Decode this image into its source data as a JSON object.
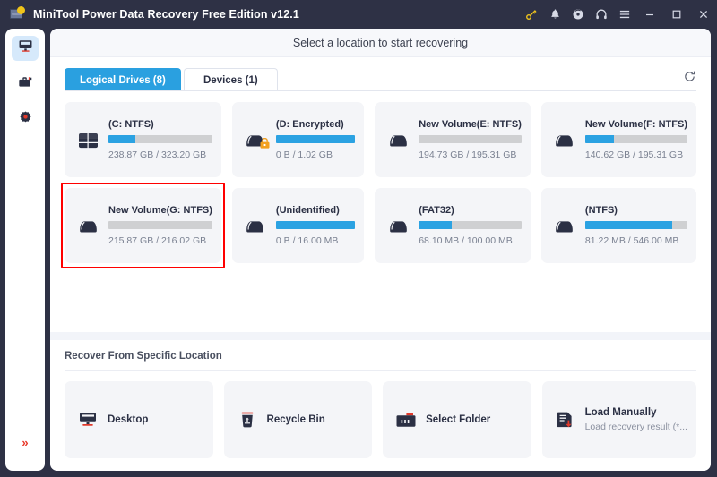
{
  "window": {
    "title": "MiniTool Power Data Recovery Free Edition v12.1",
    "logo_icon": "minitool-logo-icon",
    "controls": [
      {
        "name": "key-icon",
        "glyph": "key"
      },
      {
        "name": "bell-icon",
        "glyph": "bell"
      },
      {
        "name": "disc-icon",
        "glyph": "disc"
      },
      {
        "name": "headphones-icon",
        "glyph": "headphones"
      },
      {
        "name": "menu-icon",
        "glyph": "hamburger"
      },
      {
        "name": "minimize-button",
        "glyph": "minimize"
      },
      {
        "name": "maximize-button",
        "glyph": "maximize"
      },
      {
        "name": "close-button",
        "glyph": "close"
      }
    ],
    "accent_color": "#2aa0e0",
    "titlebar_color": "#2e3145",
    "key_icon_color": "#f2c61d",
    "selection_color": "#ff0000"
  },
  "sidebar": {
    "items": [
      {
        "name": "sidebar-item-this-pc",
        "icon": "monitor-icon",
        "active": true
      },
      {
        "name": "sidebar-item-tools",
        "icon": "toolbox-icon",
        "active": false
      },
      {
        "name": "sidebar-item-settings",
        "icon": "gear-icon",
        "active": false
      }
    ],
    "expand_icon": "double-chevron-right-icon"
  },
  "header": {
    "title": "Select a location to start recovering"
  },
  "tabs": [
    {
      "label": "Logical Drives (8)",
      "active": true
    },
    {
      "label": "Devices (1)",
      "active": false
    }
  ],
  "toolbar": {
    "refresh_icon": "refresh-icon"
  },
  "drives": [
    {
      "name": "(C: NTFS)",
      "size": "238.87 GB / 323.20 GB",
      "fill_percent": 26,
      "icon": "windows-drive-icon",
      "locked": false,
      "selected": false
    },
    {
      "name": "(D: Encrypted)",
      "size": "0 B / 1.02 GB",
      "fill_percent": 100,
      "icon": "drive-icon",
      "locked": true,
      "selected": false
    },
    {
      "name": "New Volume(E: NTFS)",
      "size": "194.73 GB / 195.31 GB",
      "fill_percent": 0,
      "icon": "drive-icon",
      "locked": false,
      "selected": false
    },
    {
      "name": "New Volume(F: NTFS)",
      "size": "140.62 GB / 195.31 GB",
      "fill_percent": 28,
      "icon": "drive-icon",
      "locked": false,
      "selected": false
    },
    {
      "name": "New Volume(G: NTFS)",
      "size": "215.87 GB / 216.02 GB",
      "fill_percent": 0,
      "icon": "drive-icon",
      "locked": false,
      "selected": true
    },
    {
      "name": "(Unidentified)",
      "size": "0 B / 16.00 MB",
      "fill_percent": 100,
      "icon": "drive-icon",
      "locked": false,
      "selected": false
    },
    {
      "name": "(FAT32)",
      "size": "68.10 MB / 100.00 MB",
      "fill_percent": 32,
      "icon": "drive-icon",
      "locked": false,
      "selected": false
    },
    {
      "name": "(NTFS)",
      "size": "81.22 MB / 546.00 MB",
      "fill_percent": 85,
      "icon": "drive-icon",
      "locked": false,
      "selected": false
    }
  ],
  "specific_location": {
    "title": "Recover From Specific Location",
    "cards": [
      {
        "label": "Desktop",
        "sub": "",
        "icon": "desktop-icon"
      },
      {
        "label": "Recycle Bin",
        "sub": "",
        "icon": "recycle-bin-icon"
      },
      {
        "label": "Select Folder",
        "sub": "",
        "icon": "folder-icon"
      },
      {
        "label": "Load Manually",
        "sub": "Load recovery result (*...",
        "icon": "load-file-icon"
      }
    ]
  }
}
